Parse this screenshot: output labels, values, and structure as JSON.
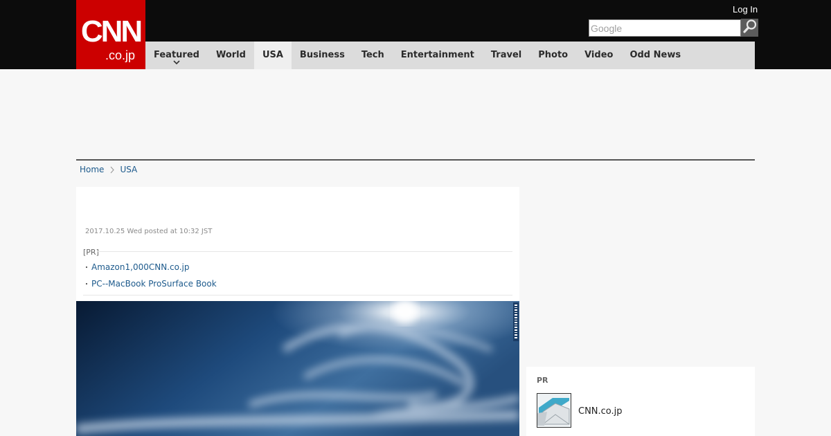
{
  "logo": {
    "line1": "CNN",
    "line2": ".co.jp"
  },
  "header": {
    "login_label": "Log In",
    "search_placeholder": "Google"
  },
  "nav": {
    "items": [
      {
        "label": "Featured"
      },
      {
        "label": "World"
      },
      {
        "label": "USA"
      },
      {
        "label": "Business"
      },
      {
        "label": "Tech"
      },
      {
        "label": "Entertainment"
      },
      {
        "label": "Travel"
      },
      {
        "label": "Photo"
      },
      {
        "label": "Video"
      },
      {
        "label": "Odd News"
      }
    ],
    "active_index": 2
  },
  "breadcrumb": {
    "home": "Home",
    "current": "USA"
  },
  "article": {
    "posted": "2017.10.25 Wed posted at 10:32 JST",
    "pr": {
      "label": "[PR]",
      "links": [
        {
          "bullet": "・",
          "text": "Amazon1,000CNN.co.jp"
        },
        {
          "bullet": "・",
          "text": "PC--MacBook ProSurface Book"
        }
      ]
    }
  },
  "sidebar": {
    "pr_label": "PR",
    "pr_item_text": "CNN.co.jp"
  },
  "colors": {
    "brand_red": "#cc0000",
    "topbar": "#0c0c0c",
    "nav_bg": "#dcdcdc",
    "link": "#1d5a8c"
  },
  "icons": {
    "search": "magnifier-icon",
    "breadcrumb_separator": "chevron-right-icon",
    "nav_dropdown": "chevron-down-icon"
  }
}
